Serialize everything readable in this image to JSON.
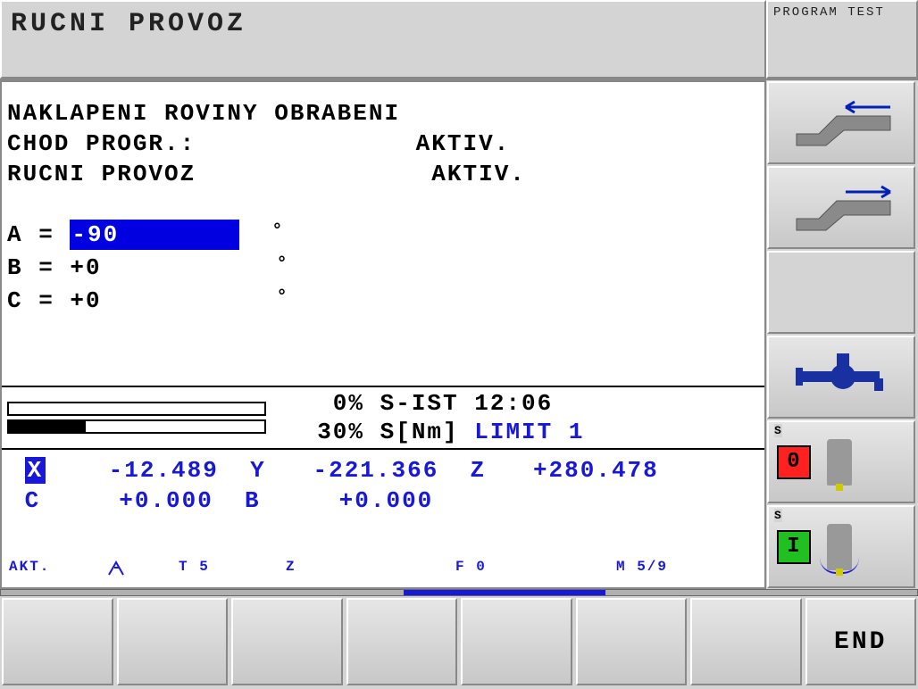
{
  "header": {
    "title": "RUCNI PROVOZ",
    "right_label": "PROGRAM TEST"
  },
  "plane": {
    "title": "NAKLAPENI ROVINY OBRABENI",
    "prog_label": "CHOD PROGR.:",
    "prog_val": "AKTIV.",
    "manual_label": "RUCNI PROVOZ",
    "manual_val": "AKTIV.",
    "angles": {
      "A_label": "A",
      "A_val": "-90",
      "B_label": "B",
      "B_val": "+0",
      "C_label": "C",
      "C_val": "+0"
    }
  },
  "spindle": {
    "bar1_pct": 0,
    "bar2_pct": 30,
    "sist_pct": "0%",
    "sist_label": "S-IST",
    "time": "12:06",
    "snm_pct": "30%",
    "snm_label": "S[Nm]",
    "limit": "LIMIT 1"
  },
  "coords": {
    "X": "-12.489",
    "Y": "-221.366",
    "Z": "+280.478",
    "C": "+0.000",
    "B": "+0.000"
  },
  "footer": {
    "akt": "AKT.",
    "tool": "T 5",
    "z": "Z",
    "f": "F 0",
    "m": "M 5/9"
  },
  "sidekeys": {
    "s0": "0",
    "sI": "I"
  },
  "bottomkeys": {
    "end": "END"
  },
  "scrollbar": {
    "thumb_left_pct": 44,
    "thumb_width_pct": 22
  }
}
